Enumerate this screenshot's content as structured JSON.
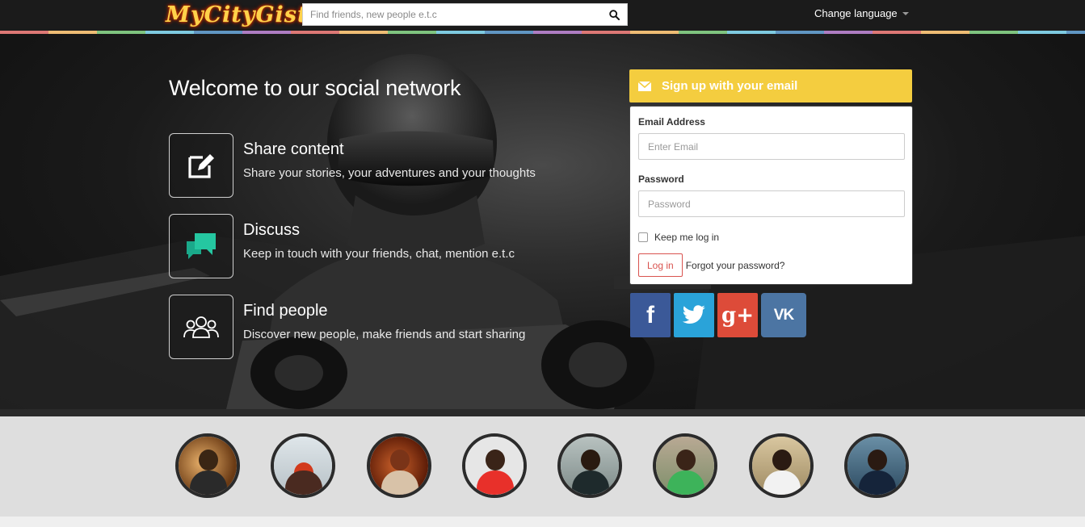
{
  "header": {
    "logo_text": "MyCityGist",
    "search_placeholder": "Find friends, new people e.t.c",
    "change_language": "Change language"
  },
  "hero": {
    "welcome": "Welcome to our social network",
    "features": [
      {
        "icon": "edit-icon",
        "title": "Share content",
        "desc": "Share your stories, your adventures and your thoughts"
      },
      {
        "icon": "chat-icon",
        "title": "Discuss",
        "desc": "Keep in touch with your friends, chat, mention e.t.c"
      },
      {
        "icon": "people-icon",
        "title": "Find people",
        "desc": "Discover new people, make friends and start sharing"
      }
    ]
  },
  "signup": {
    "header": "Sign up with your email",
    "email_label": "Email Address",
    "email_placeholder": "Enter Email",
    "password_label": "Password",
    "password_placeholder": "Password",
    "remember": "Keep me log in",
    "login_button": "Log in",
    "forgot": "Forgot your password?"
  },
  "socials": [
    {
      "name": "facebook",
      "glyph": "f"
    },
    {
      "name": "twitter",
      "glyph": ""
    },
    {
      "name": "google-plus",
      "glyph": "g+"
    },
    {
      "name": "vk",
      "glyph": "VK"
    }
  ],
  "colors": {
    "accent_yellow": "#f4cd3f",
    "login_red": "#d9534f",
    "topbar": "#1b1b1b"
  }
}
